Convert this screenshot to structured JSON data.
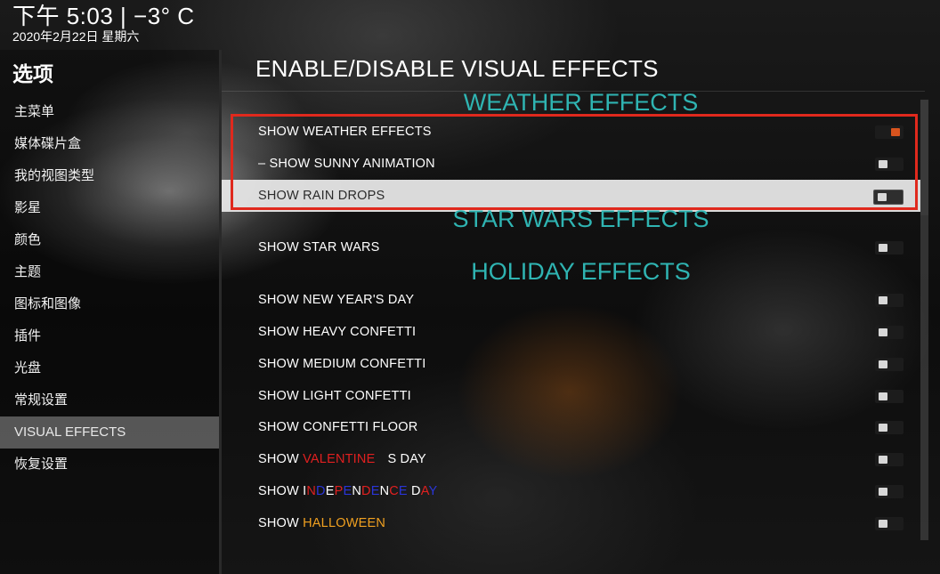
{
  "clock": {
    "time": "下午 5:03 | −3° C",
    "date": "2020年2月22日 星期六"
  },
  "sidebar": {
    "title": "选项",
    "items": [
      {
        "label": "主菜单"
      },
      {
        "label": "媒体碟片盒"
      },
      {
        "label": "我的视图类型"
      },
      {
        "label": "影星"
      },
      {
        "label": "颜色"
      },
      {
        "label": "主题"
      },
      {
        "label": "图标和图像"
      },
      {
        "label": "插件"
      },
      {
        "label": "光盘"
      },
      {
        "label": "常规设置"
      },
      {
        "label": "VISUAL EFFECTS",
        "active": true
      },
      {
        "label": "恢复设置"
      }
    ]
  },
  "main": {
    "title": "ENABLE/DISABLE VISUAL EFFECTS",
    "sections": {
      "weather": "WEATHER EFFECTS",
      "starwars": "STAR WARS EFFECTS",
      "holiday": "HOLIDAY EFFECTS"
    },
    "rows": {
      "weather": {
        "label": "SHOW WEATHER EFFECTS",
        "on": true
      },
      "sunny": {
        "label": "– SHOW SUNNY ANIMATION",
        "on": false
      },
      "rain": {
        "label": "SHOW RAIN DROPS",
        "on": false,
        "selected": true
      },
      "starwars": {
        "label": "SHOW STAR WARS",
        "on": false
      },
      "newyear": {
        "label": "SHOW NEW YEAR'S DAY",
        "on": false
      },
      "heavy": {
        "label": "SHOW HEAVY CONFETTI",
        "on": false
      },
      "medium": {
        "label": "SHOW MEDIUM CONFETTI",
        "on": false
      },
      "light": {
        "label": "SHOW LIGHT CONFETTI",
        "on": false
      },
      "floor": {
        "label": "SHOW CONFETTI FLOOR",
        "on": false
      },
      "valentine": {
        "prefix": "SHOW ",
        "word": "VALENTINE",
        "suffix": "S DAY",
        "on": false
      },
      "independence": {
        "prefix": "SHOW ",
        "word": "INDEPENDENCE DAY",
        "on": false
      },
      "halloween": {
        "prefix": "SHOW ",
        "word": "HALLOWEEN",
        "on": false
      }
    }
  },
  "colors": {
    "section": "#2fb4b2",
    "toggle_on": "#d8541e",
    "highlight_box": "#e0291d",
    "valentine": "#e02020",
    "halloween": "#f0a020",
    "independence": [
      "#ffffff",
      "#e02020",
      "#2a35d8"
    ]
  }
}
